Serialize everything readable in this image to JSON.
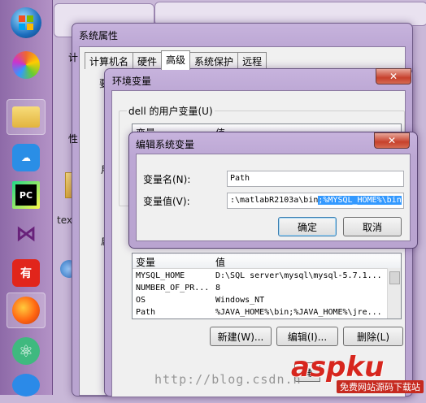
{
  "desktop": {
    "file_label": "text"
  },
  "system_properties": {
    "title": "系统属性",
    "tabs": [
      "计算机名",
      "硬件",
      "高级",
      "系统保护",
      "远程"
    ],
    "side_glyphs": [
      "计",
      "要",
      "性",
      "用",
      "启"
    ]
  },
  "env_vars": {
    "title": "环境变量",
    "user_group_label": "dell 的用户变量(U)",
    "user_header": {
      "name": "变量",
      "value": "值"
    },
    "system_header": {
      "name": "变量",
      "value": "值"
    },
    "system_rows": [
      {
        "name": "MYSQL_HOME",
        "value": "D:\\SQL server\\mysql\\mysql-5.7.1..."
      },
      {
        "name": "NUMBER_OF_PR...",
        "value": "8"
      },
      {
        "name": "OS",
        "value": "Windows_NT"
      },
      {
        "name": "Path",
        "value": "%JAVA_HOME%\\bin;%JAVA_HOME%\\jre..."
      }
    ],
    "buttons": {
      "new": "新建(W)...",
      "edit": "编辑(I)...",
      "delete": "删除(L)"
    },
    "ok_partial": "确"
  },
  "edit_dialog": {
    "title": "编辑系统变量",
    "name_label": "变量名(N):",
    "value_label": "变量值(V):",
    "name_value": "Path",
    "value_prefix": ":\\matlabR2103a\\bin",
    "value_selected": ";%MYSQL_HOME%\\bin",
    "ok": "确定",
    "cancel": "取消"
  },
  "watermark": {
    "url": "http://blog.csdn.n",
    "logo": "aspku",
    "logo_sub": "免费网站源码下载站"
  },
  "colors": {
    "accent": "#3399ff",
    "close": "#c7412c",
    "frame": "#bca7d4"
  }
}
